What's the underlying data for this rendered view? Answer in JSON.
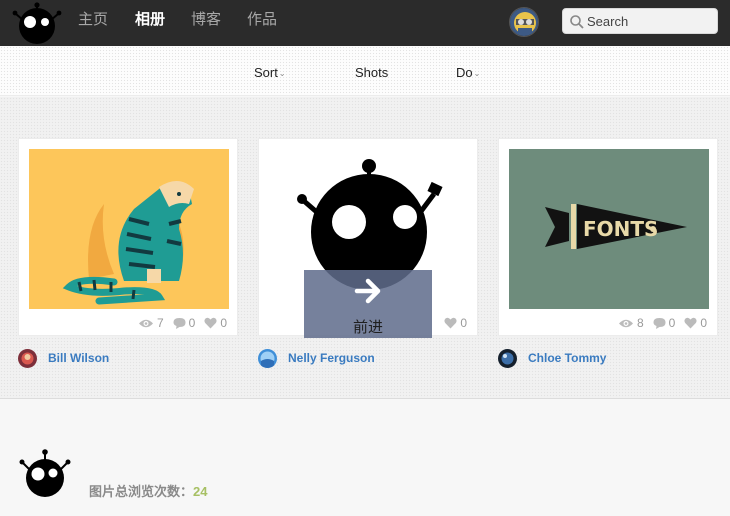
{
  "nav": {
    "items": [
      {
        "label": "主页",
        "active": false
      },
      {
        "label": "相册",
        "active": true
      },
      {
        "label": "博客",
        "active": false
      },
      {
        "label": "作品",
        "active": false
      }
    ],
    "logo_icon": "robot-logo-icon",
    "avatar_icon": "user-avatar",
    "search": {
      "placeholder": "Search",
      "icon": "search-icon"
    }
  },
  "filters": {
    "sort": {
      "label": "Sort",
      "caret": "⌄"
    },
    "shots": {
      "label": "Shots"
    },
    "do": {
      "label": "Do",
      "caret": "⌄"
    }
  },
  "shots": [
    {
      "image": "tiger-illustration",
      "views": "7",
      "comments": "0",
      "likes": "0",
      "author": "Bill Wilson"
    },
    {
      "image": "robot-illustration",
      "views": "",
      "comments": "",
      "likes": "0",
      "author": "Nelly Ferguson",
      "overlay": {
        "label": "前进",
        "icon": "arrow-right-icon"
      }
    },
    {
      "image": "fonts-pennant-illustration",
      "views": "8",
      "comments": "0",
      "likes": "0",
      "author": "Chloe Tommy"
    }
  ],
  "footer": {
    "label": "图片总浏览次数：",
    "count": "24"
  },
  "colors": {
    "topbar": "#2b2b2b",
    "tiger_bg": "#fdc65a",
    "fonts_bg": "#6e8c7c",
    "author_link": "#3a7bc0",
    "footer_count": "#a7c064"
  }
}
